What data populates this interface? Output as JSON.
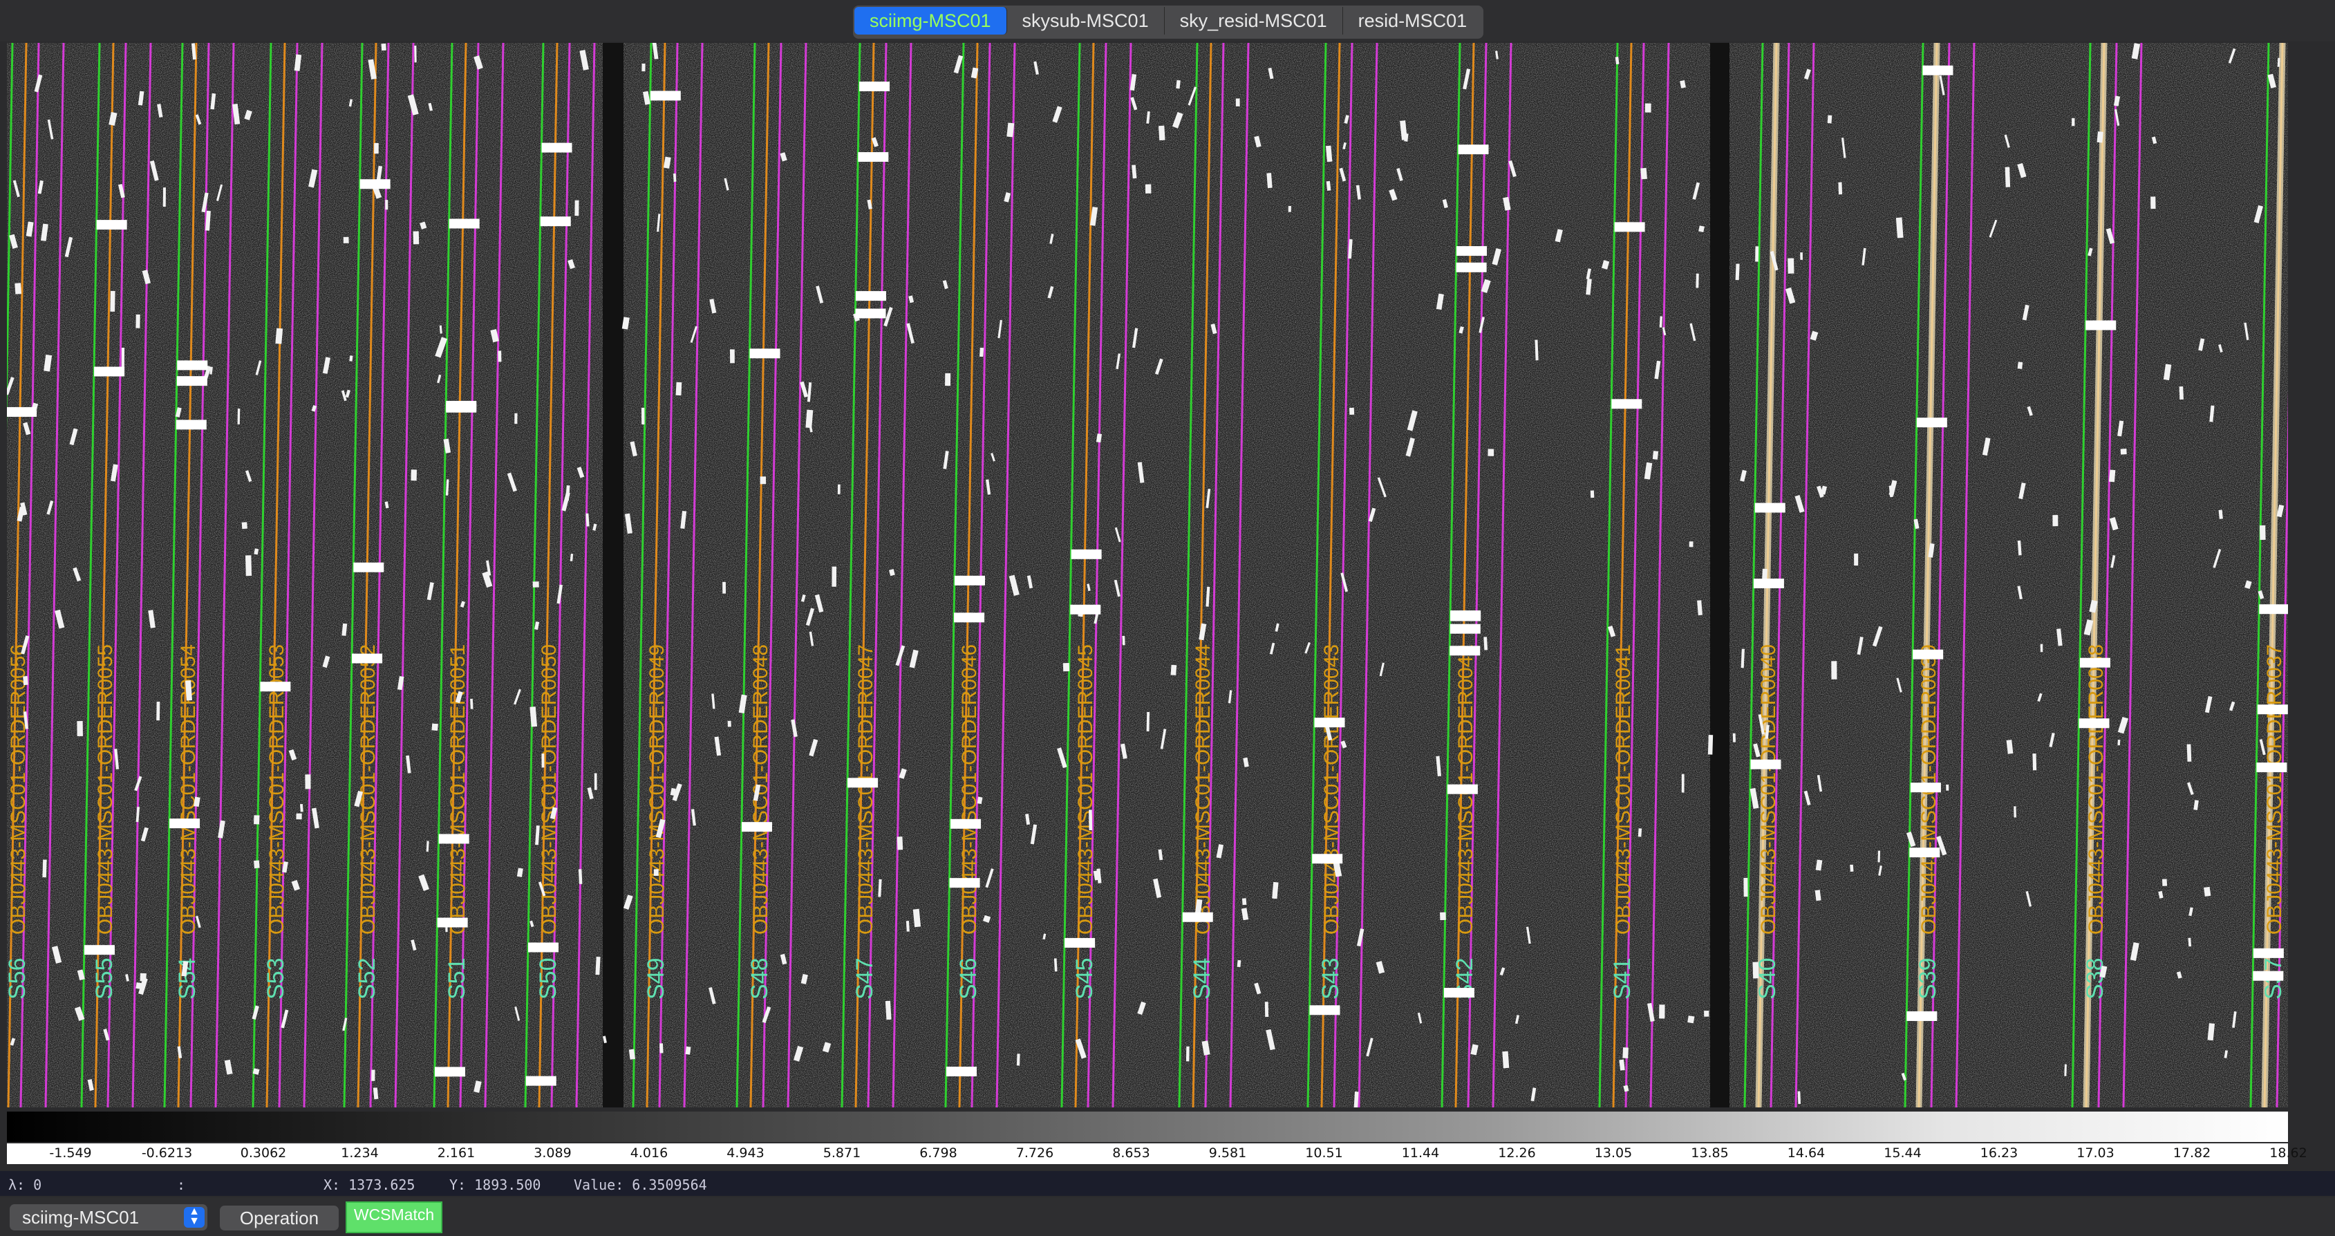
{
  "tabs": [
    {
      "label": "sciimg-MSC01",
      "active": true
    },
    {
      "label": "skysub-MSC01",
      "active": false
    },
    {
      "label": "sky_resid-MSC01",
      "active": false
    },
    {
      "label": "resid-MSC01",
      "active": false
    }
  ],
  "image": {
    "slits": [
      "S56",
      "S55",
      "S54",
      "S53",
      "S52",
      "S51",
      "S50",
      "S49",
      "S48",
      "S47",
      "S46",
      "S45",
      "S44",
      "S43",
      "S42",
      "S41",
      "S40",
      "S39",
      "S38",
      "S37"
    ],
    "orders": [
      "OBJ0443-MSC01-ORDER0056",
      "OBJ0443-MSC01-ORDER0055",
      "OBJ0443-MSC01-ORDER0054",
      "OBJ0443-MSC01-ORDER0053",
      "OBJ0443-MSC01-ORDER0052",
      "OBJ0443-MSC01-ORDER0051",
      "OBJ0443-MSC01-ORDER0050",
      "OBJ0443-MSC01-ORDER0049",
      "OBJ0443-MSC01-ORDER0048",
      "OBJ0443-MSC01-ORDER0047",
      "OBJ0443-MSC01-ORDER0046",
      "OBJ0443-MSC01-ORDER0045",
      "OBJ0443-MSC01-ORDER0044",
      "OBJ0443-MSC01-ORDER0043",
      "OBJ0443-MSC01-ORDER0042",
      "OBJ0443-MSC01-ORDER0041",
      "OBJ0443-MSC01-ORDER0040",
      "OBJ0443-MSC01-ORDER0039",
      "OBJ0443-MSC01-ORDER0038",
      "OBJ0443-MSC01-ORDER0037"
    ],
    "colors": {
      "slit_edge": "#2fd12f",
      "slit_boundary": "#d43bd6",
      "trace": "#e08a1c",
      "slit_label": "#5fe0b0",
      "order_label": "#d89a10"
    }
  },
  "colorbar": {
    "ticks": [
      "-1.549",
      "-0.6213",
      "0.3062",
      "1.234",
      "2.161",
      "3.089",
      "4.016",
      "4.943",
      "5.871",
      "6.798",
      "7.726",
      "8.653",
      "9.581",
      "10.51",
      "11.44",
      "12.26",
      "13.05",
      "13.85",
      "14.64",
      "15.44",
      "16.23",
      "17.03",
      "17.82",
      "18.62"
    ]
  },
  "status": {
    "lambda": "λ: 0",
    "colon": ":",
    "x": "X: 1373.625",
    "y": "Y: 1893.500",
    "value": "Value: 6.3509564"
  },
  "bottom": {
    "select_value": "sciimg-MSC01",
    "operation_label": "Operation",
    "wcsmatch_label": "WCSMatch"
  }
}
